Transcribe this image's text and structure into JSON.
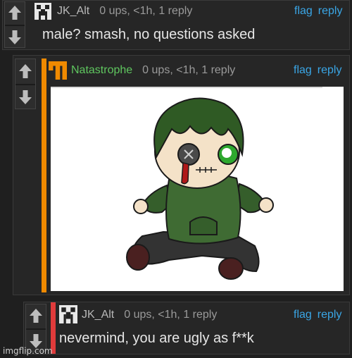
{
  "colors": {
    "background": "#1f1f1f",
    "panel": "#262626",
    "link": "#3aa6e6",
    "accent_orange": "#f08a00",
    "accent_red": "#e03b3b",
    "username_green": "#5fc65f"
  },
  "comments": [
    {
      "username": "JK_Alt",
      "meta": "0 ups, <1h, 1 reply",
      "text": "male? smash, no questions asked",
      "flag": "flag",
      "reply": "reply",
      "avatar_icon": "pixel-creeper-avatar-icon"
    },
    {
      "username": "Natastrophe",
      "meta": "0 ups, <1h, 1 reply",
      "flag": "flag",
      "reply": "reply",
      "avatar_icon": "orange-pixel-avatar-icon",
      "image": "chibi character in green hoodie with button eye and bleeding eye"
    },
    {
      "username": "JK_Alt",
      "meta": "0 ups, <1h, 1 reply",
      "text": "nevermind, you are ugly as f**k",
      "flag": "flag",
      "reply": "reply",
      "avatar_icon": "pixel-creeper-avatar-icon"
    }
  ],
  "watermark": "imgflip.com"
}
